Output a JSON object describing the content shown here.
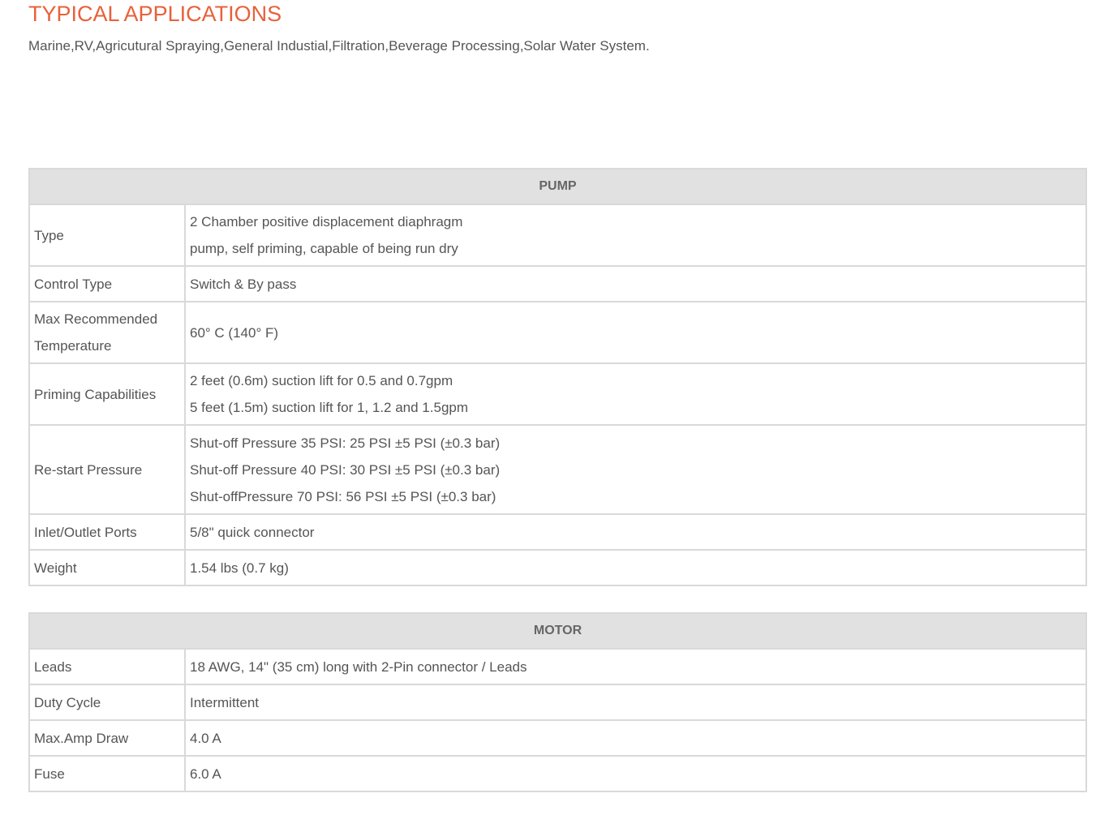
{
  "typical_applications": {
    "title": "TYPICAL APPLICATIONS",
    "text": "Marine,RV,Agricutural Spraying,General Industial,Filtration,Beverage Processing,Solar Water System."
  },
  "pump": {
    "header": "PUMP",
    "rows": [
      {
        "label": "Type",
        "lines": [
          "2 Chamber positive displacement diaphragm",
          "pump, self priming, capable of being run dry"
        ]
      },
      {
        "label": "Control Type",
        "lines": [
          "Switch & By pass"
        ]
      },
      {
        "label_lines": [
          "Max Recommended",
          "Temperature"
        ],
        "lines": [
          "60° C (140° F)"
        ]
      },
      {
        "label": "Priming Capabilities",
        "lines": [
          "2 feet (0.6m) suction lift for 0.5 and 0.7gpm",
          "5 feet (1.5m) suction lift for 1, 1.2 and 1.5gpm"
        ]
      },
      {
        "label": "Re-start Pressure",
        "lines": [
          "Shut-off Pressure 35 PSI: 25 PSI ±5 PSI (±0.3 bar)",
          "Shut-off Pressure 40 PSI: 30 PSI ±5 PSI (±0.3 bar)",
          "Shut-offPressure 70 PSI: 56 PSI ±5 PSI (±0.3 bar)"
        ]
      },
      {
        "label": "Inlet/Outlet Ports",
        "lines": [
          "5/8\" quick connector"
        ]
      },
      {
        "label": "Weight",
        "lines": [
          "1.54 lbs (0.7 kg)"
        ]
      }
    ]
  },
  "motor": {
    "header": "MOTOR",
    "rows": [
      {
        "label": "Leads",
        "lines": [
          "18 AWG, 14\" (35 cm) long with 2-Pin connector / Leads"
        ]
      },
      {
        "label": "Duty Cycle",
        "lines": [
          "Intermittent"
        ]
      },
      {
        "label": "Max.Amp Draw",
        "lines": [
          "4.0 A"
        ]
      },
      {
        "label": "Fuse",
        "lines": [
          "6.0 A"
        ]
      }
    ]
  }
}
